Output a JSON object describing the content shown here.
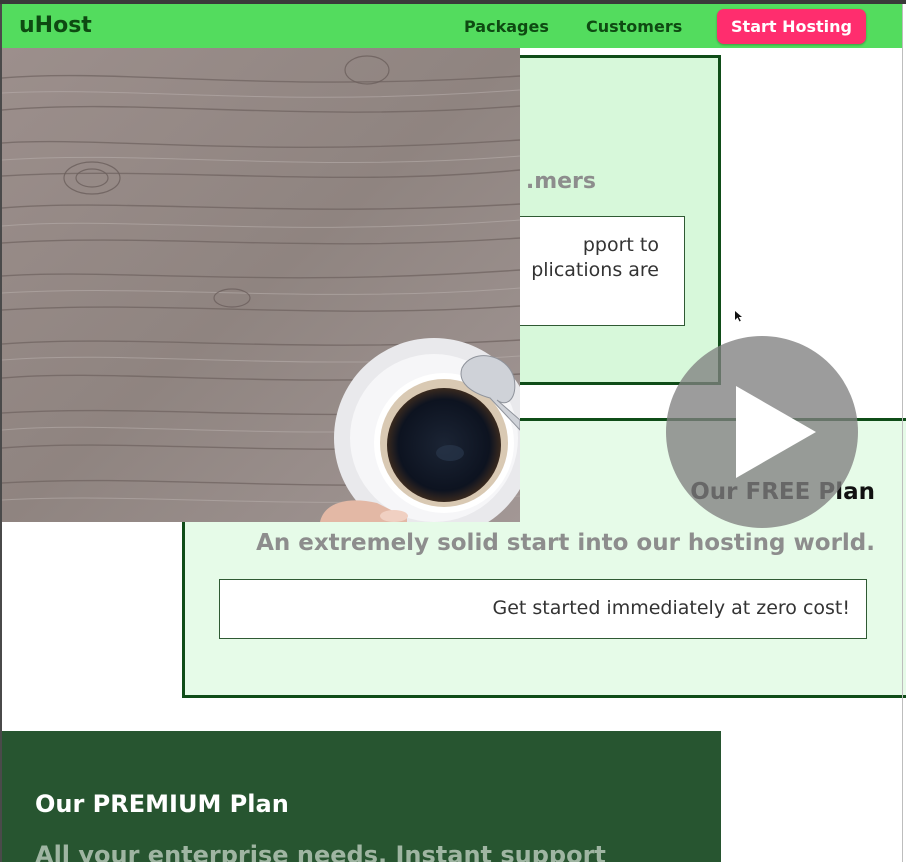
{
  "header": {
    "brand": "uHost",
    "nav": [
      {
        "label": "Packages"
      },
      {
        "label": "Customers"
      }
    ],
    "cta_label": "Start Hosting",
    "colors": {
      "bar": "#53dc5e",
      "text": "#0e4a12",
      "cta": "#ff2d6e"
    }
  },
  "plans": {
    "customer_plan": {
      "subtitle_visible": "mers.",
      "box_lines": [
        "pport to",
        "plications are"
      ]
    },
    "free_plan": {
      "title": "Our FREE Plan",
      "subtitle": "An extremely solid start into our hosting world.",
      "box_text": "Get started immediately at zero cost!"
    },
    "premium_plan": {
      "title": "Our PREMIUM Plan",
      "subtitle": "All your enterprise needs. Instant support"
    }
  },
  "media": {
    "photo_icon": "coffee-on-wood-table-image",
    "play_icon": "play-icon"
  }
}
